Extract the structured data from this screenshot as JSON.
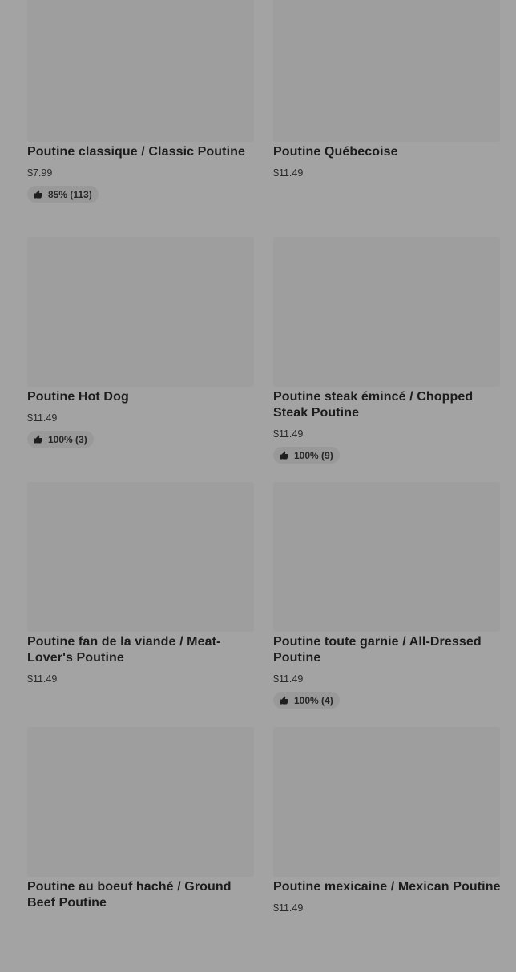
{
  "menu": {
    "items": [
      {
        "name": "Poutine classique / Classic Poutine",
        "price": "$7.99",
        "rating": "85% (113)"
      },
      {
        "name": "Poutine Québecoise",
        "price": "$11.49",
        "rating": null
      },
      {
        "name": "Poutine Hot Dog",
        "price": "$11.49",
        "rating": "100% (3)"
      },
      {
        "name": "Poutine steak émincé / Chopped Steak Poutine",
        "price": "$11.49",
        "rating": "100% (9)"
      },
      {
        "name": "Poutine fan de la viande / Meat-Lover's Poutine",
        "price": "$11.49",
        "rating": null
      },
      {
        "name": "Poutine toute garnie / All-Dressed Poutine",
        "price": "$11.49",
        "rating": "100% (4)"
      },
      {
        "name": "Poutine au boeuf haché / Ground Beef Poutine",
        "price": "",
        "rating": null
      },
      {
        "name": "Poutine mexicaine / Mexican Poutine",
        "price": "$11.49",
        "rating": null
      }
    ]
  },
  "icons": {
    "rating": "thumbs-up-icon"
  },
  "colors": {
    "overlay": "#a3a3a3",
    "image_placeholder": "#9e9e9e",
    "rating_badge": "#999999"
  }
}
